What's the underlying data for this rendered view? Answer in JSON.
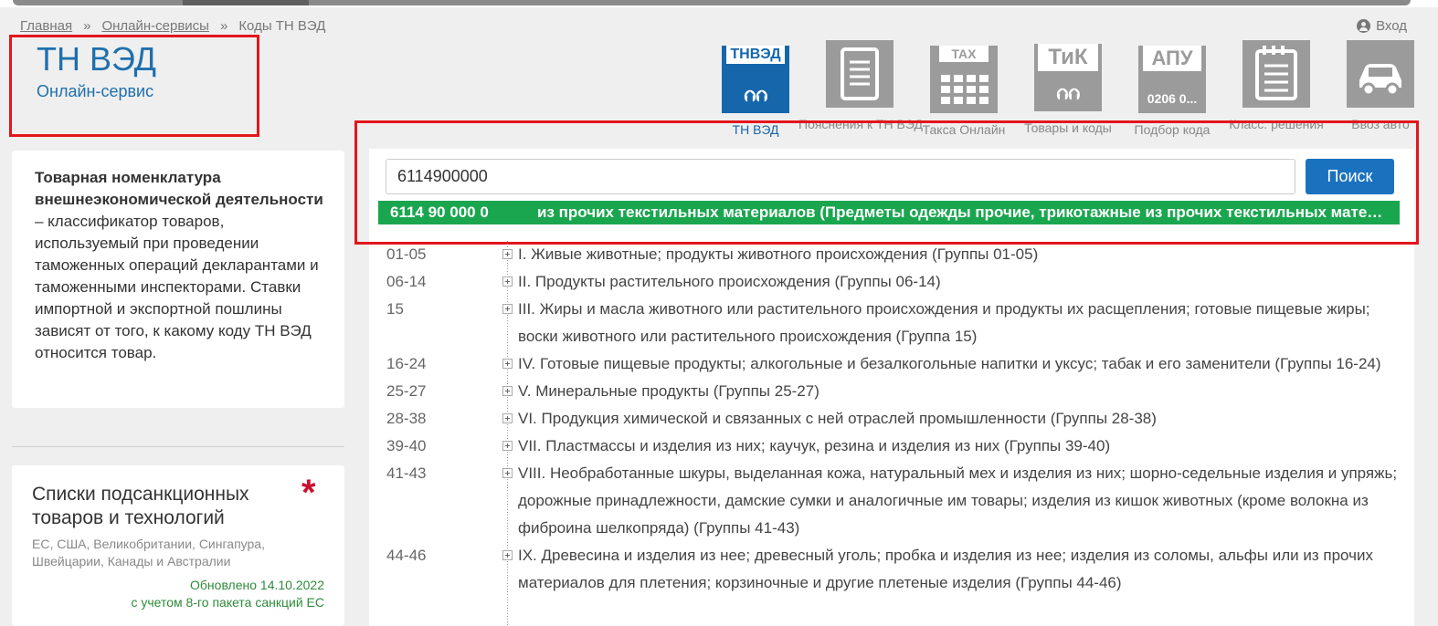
{
  "breadcrumb": {
    "items": [
      "Главная",
      "Онлайн-сервисы",
      "Коды ТН ВЭД"
    ],
    "separator": "»"
  },
  "login": {
    "label": "Вход"
  },
  "brand": {
    "title": "ТН ВЭД",
    "subtitle": "Онлайн-сервис"
  },
  "services": [
    {
      "label": "ТН ВЭД",
      "tile_text": "ТНВЭД",
      "icon": "tnved-arrows-icon",
      "active": true
    },
    {
      "label": "Пояснения к ТН ВЭД",
      "icon": "scroll-document-icon"
    },
    {
      "label": "Такса Онлайн",
      "tile_text": "TAX",
      "icon": "calculator-icon"
    },
    {
      "label": "Товары и коды",
      "tile_text": "ТиК",
      "icon": "tik-arrows-icon"
    },
    {
      "label": "Подбор кода",
      "tile_text": "АПУ",
      "tile_code": "0206 0...",
      "icon": "apu-icon"
    },
    {
      "label": "Класс. решения",
      "icon": "notepad-list-icon"
    },
    {
      "label": "Ввоз авто",
      "icon": "car-icon"
    }
  ],
  "description": {
    "bold": "Товарная номенклатура внешнеэкономической деятельности",
    "rest": " – классификатор товаров, используемый при проведении таможенных операций декларантами и таможенными инспекторами. Ставки импортной и экспортной пошлины зависят от того, к какому коду ТН ВЭД относится товар."
  },
  "sanctions": {
    "title": "Списки подсанкционных товаров и технологий",
    "subtitle": "ЕС, США, Великобритании, Сингапура, Швейцарии, Канады и Австралии",
    "updated_line1": "Обновлено 14.10.2022",
    "updated_line2": "с учетом 8-го пакета санкций ЕС",
    "accent": "#c8102e"
  },
  "search": {
    "value": "6114900000",
    "button": "Поиск",
    "suggestion_code": "6114 90 000 0",
    "suggestion_text": "из прочих текстильных материалов (Предметы одежды прочие, трикотажные из прочих текстильных материалов)",
    "suggestion_color": "#1aa64f"
  },
  "tree": [
    {
      "group": "01-05",
      "text": "I. Живые животные; продукты животного происхождения (Группы 01-05)"
    },
    {
      "group": "06-14",
      "text": "II. Продукты растительного происхождения (Группы 06-14)"
    },
    {
      "group": "15",
      "text": "III. Жиры и масла животного или растительного происхождения и продукты их расщепления; готовые пищевые жиры; воски животного или растительного происхождения (Группа 15)"
    },
    {
      "group": "16-24",
      "text": "IV. Готовые пищевые продукты; алкогольные и безалкогольные напитки и уксус; табак и его заменители (Группы 16-24)"
    },
    {
      "group": "25-27",
      "text": "V. Минеральные продукты (Группы 25-27)"
    },
    {
      "group": "28-38",
      "text": "VI. Продукция химической и связанных с ней отраслей промышленности (Группы 28-38)"
    },
    {
      "group": "39-40",
      "text": "VII. Пластмассы и изделия из них; каучук, резина и изделия из них (Группы 39-40)"
    },
    {
      "group": "41-43",
      "text": "VIII. Необработанные шкуры, выделанная кожа, натуральный мех и изделия из них; шорно-седельные изделия и упряжь; дорожные принадлежности, дамские сумки и аналогичные им товары; изделия из кишок животных (кроме волокна из фиброина шелкопряда) (Группы 41-43)"
    },
    {
      "group": "44-46",
      "text": "IX. Древесина и изделия из нее; древесный уголь; пробка и изделия из нее; изделия из соломы, альфы или из прочих материалов для плетения; корзиночные и другие плетеные изделия (Группы 44-46)"
    }
  ]
}
